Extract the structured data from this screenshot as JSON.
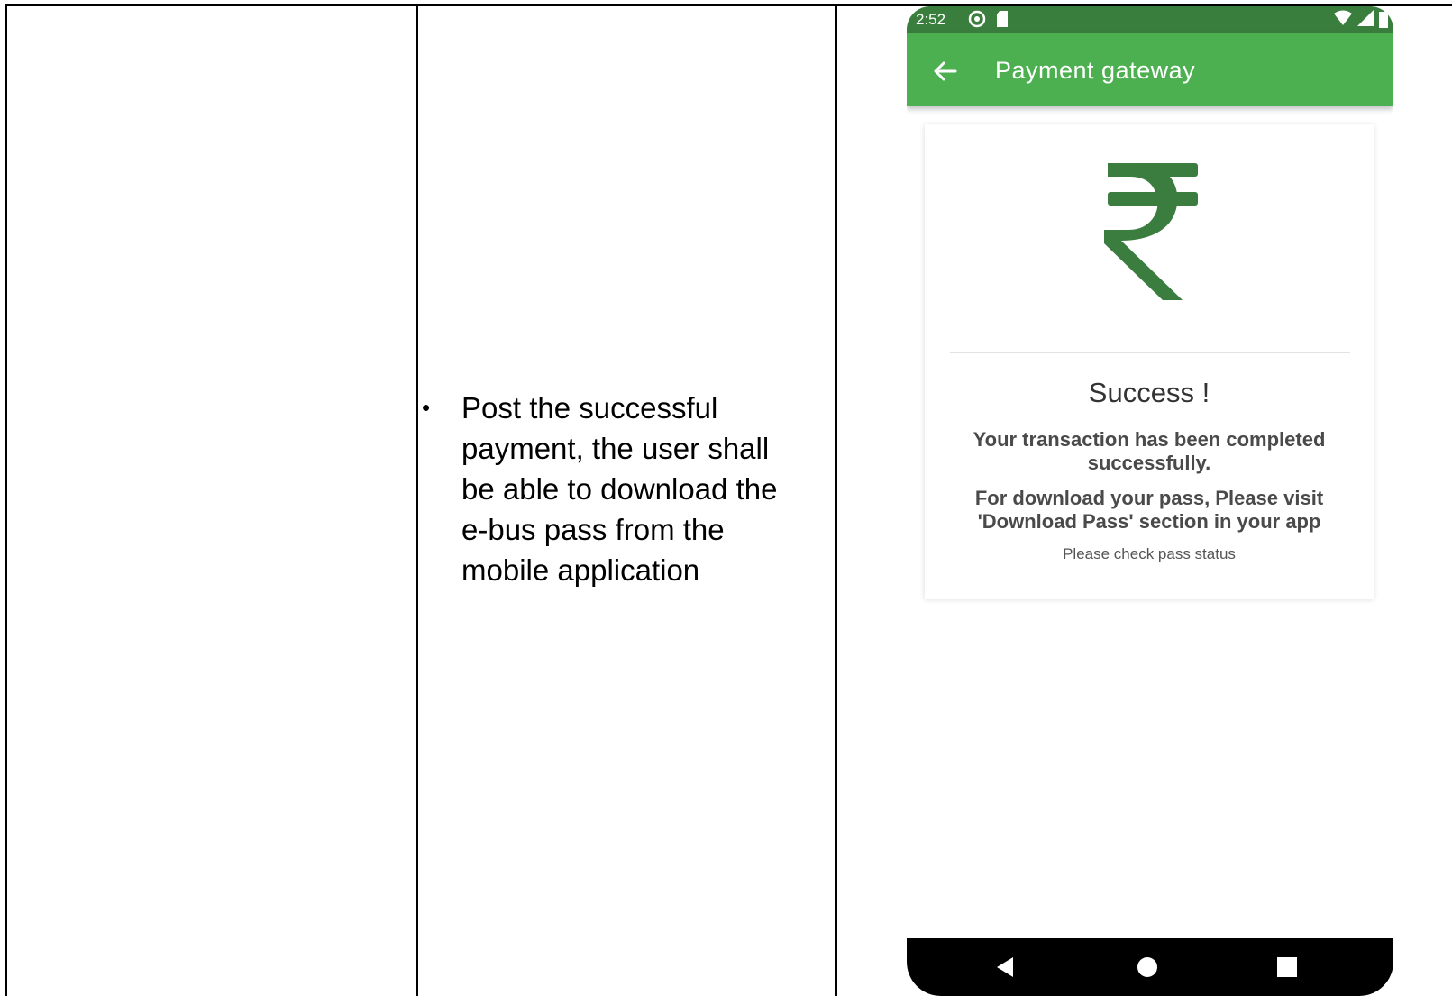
{
  "document": {
    "bullet": "•",
    "bullet_text": "Post the successful payment, the user shall be able to download the e-bus pass from the mobile application"
  },
  "phone": {
    "status_bar": {
      "time": "2:52",
      "left_icons": [
        "sync-icon",
        "sd-card-icon"
      ],
      "right_icons": [
        "wifi-icon",
        "signal-icon",
        "battery-icon"
      ],
      "color": "#3a7e3e"
    },
    "app_bar": {
      "back_icon": "arrow-left-icon",
      "title": "Payment gateway",
      "color": "#4caf50"
    },
    "card": {
      "icon": "rupee-icon",
      "icon_color": "#3a7d3f",
      "title": "Success !",
      "message1": "Your transaction has been completed successfully.",
      "message2": "For download your pass, Please visit 'Download Pass' section in your app",
      "message3": "Please check pass status"
    },
    "nav_bar": {
      "back_icon": "triangle-back-icon",
      "home_icon": "circle-home-icon",
      "recents_icon": "square-recents-icon"
    }
  }
}
